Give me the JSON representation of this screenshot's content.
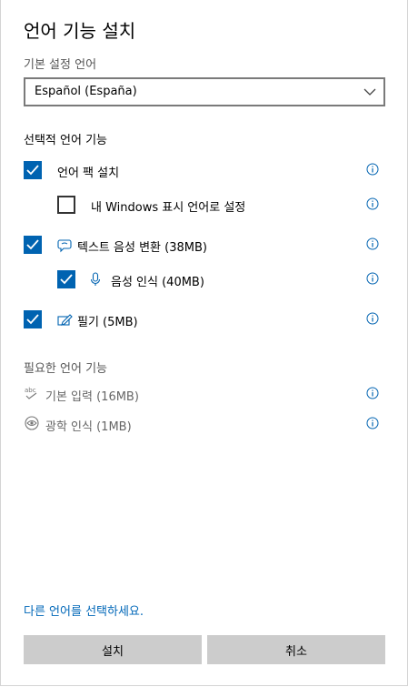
{
  "dialog": {
    "title": "언어 기능 설치"
  },
  "preferred": {
    "label": "기본 설정 언어",
    "selected": "Español (España)"
  },
  "optional": {
    "heading": "선택적 언어 기능",
    "items": [
      {
        "label": "언어 팩 설치",
        "checked": true
      },
      {
        "label": "내 Windows 표시 언어로 설정",
        "checked": false
      },
      {
        "label": "텍스트 음성 변환 (38MB)",
        "checked": true,
        "icon": "speech-bubble-icon"
      },
      {
        "label": "음성 인식 (40MB)",
        "checked": true,
        "icon": "microphone-icon"
      },
      {
        "label": "필기 (5MB)",
        "checked": true,
        "icon": "pen-icon"
      }
    ]
  },
  "required": {
    "heading": "필요한 언어 기능",
    "items": [
      {
        "label": "기본 입력 (16MB)",
        "icon": "abc-spellcheck-icon"
      },
      {
        "label": "광학 인식 (1MB)",
        "icon": "eye-scan-icon"
      }
    ]
  },
  "link": {
    "text": "다른 언어를 선택하세요."
  },
  "buttons": {
    "install": "설치",
    "cancel": "취소"
  },
  "colors": {
    "accent": "#0063b1",
    "link": "#0067b8",
    "button_bg": "#cccccc"
  }
}
